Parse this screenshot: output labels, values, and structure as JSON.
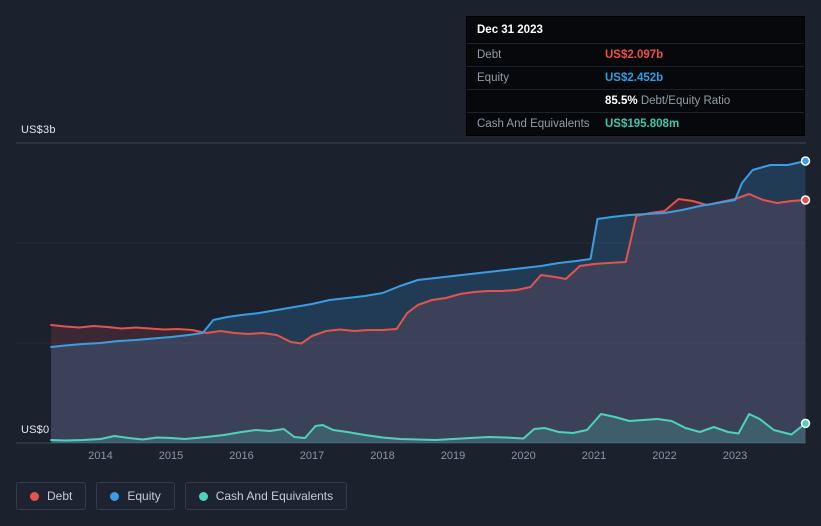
{
  "tooltip": {
    "date": "Dec 31 2023",
    "debt_label": "Debt",
    "debt_value": "US$2.097b",
    "equity_label": "Equity",
    "equity_value": "US$2.452b",
    "ratio_value": "85.5%",
    "ratio_label": "Debt/Equity Ratio",
    "cash_label": "Cash And Equivalents",
    "cash_value": "US$195.808m"
  },
  "chart": {
    "y_axis_top_label": "US$3b",
    "y_axis_bottom_label": "US$0"
  },
  "legend": {
    "items": [
      {
        "label": "Debt",
        "color": "#e5534f"
      },
      {
        "label": "Equity",
        "color": "#3b9de4"
      },
      {
        "label": "Cash And Equivalents",
        "color": "#4fd2bd"
      }
    ]
  },
  "chart_data": {
    "type": "area",
    "title": "",
    "xlabel": "",
    "ylabel": "US$",
    "unit": "US$ billions",
    "ylim": [
      0,
      3
    ],
    "x_ticks": [
      2014,
      2015,
      2016,
      2017,
      2018,
      2019,
      2020,
      2021,
      2022,
      2023
    ],
    "grid": true,
    "legend_position": "bottom-left",
    "series": [
      {
        "name": "Debt",
        "color": "#e5534f",
        "fill": "rgba(229,83,79,0.16)",
        "points": [
          [
            2013.3,
            1.18
          ],
          [
            2013.5,
            1.165
          ],
          [
            2013.7,
            1.155
          ],
          [
            2013.9,
            1.17
          ],
          [
            2014.1,
            1.16
          ],
          [
            2014.3,
            1.145
          ],
          [
            2014.5,
            1.155
          ],
          [
            2014.7,
            1.145
          ],
          [
            2014.9,
            1.135
          ],
          [
            2015.1,
            1.14
          ],
          [
            2015.3,
            1.13
          ],
          [
            2015.5,
            1.1
          ],
          [
            2015.7,
            1.12
          ],
          [
            2015.9,
            1.1
          ],
          [
            2016.1,
            1.09
          ],
          [
            2016.3,
            1.1
          ],
          [
            2016.5,
            1.08
          ],
          [
            2016.7,
            1.01
          ],
          [
            2016.85,
            0.995
          ],
          [
            2017.0,
            1.07
          ],
          [
            2017.2,
            1.12
          ],
          [
            2017.4,
            1.135
          ],
          [
            2017.6,
            1.12
          ],
          [
            2017.8,
            1.13
          ],
          [
            2018.0,
            1.13
          ],
          [
            2018.2,
            1.14
          ],
          [
            2018.35,
            1.3
          ],
          [
            2018.5,
            1.38
          ],
          [
            2018.7,
            1.43
          ],
          [
            2018.9,
            1.45
          ],
          [
            2019.1,
            1.49
          ],
          [
            2019.3,
            1.51
          ],
          [
            2019.5,
            1.52
          ],
          [
            2019.7,
            1.52
          ],
          [
            2019.9,
            1.53
          ],
          [
            2020.1,
            1.56
          ],
          [
            2020.25,
            1.68
          ],
          [
            2020.45,
            1.66
          ],
          [
            2020.6,
            1.64
          ],
          [
            2020.8,
            1.77
          ],
          [
            2021.0,
            1.79
          ],
          [
            2021.2,
            1.8
          ],
          [
            2021.45,
            1.81
          ],
          [
            2021.6,
            2.27
          ],
          [
            2021.8,
            2.3
          ],
          [
            2022.0,
            2.32
          ],
          [
            2022.2,
            2.44
          ],
          [
            2022.4,
            2.42
          ],
          [
            2022.6,
            2.38
          ],
          [
            2022.8,
            2.41
          ],
          [
            2023.0,
            2.44
          ],
          [
            2023.2,
            2.49
          ],
          [
            2023.4,
            2.43
          ],
          [
            2023.6,
            2.4
          ],
          [
            2023.8,
            2.42
          ],
          [
            2024.0,
            2.43
          ]
        ]
      },
      {
        "name": "Equity",
        "color": "#3b9de4",
        "fill": "rgba(59,157,228,0.22)",
        "points": [
          [
            2013.3,
            0.96
          ],
          [
            2013.5,
            0.975
          ],
          [
            2013.75,
            0.99
          ],
          [
            2014.0,
            1.0
          ],
          [
            2014.25,
            1.02
          ],
          [
            2014.5,
            1.03
          ],
          [
            2014.75,
            1.045
          ],
          [
            2015.0,
            1.06
          ],
          [
            2015.25,
            1.08
          ],
          [
            2015.45,
            1.1
          ],
          [
            2015.6,
            1.23
          ],
          [
            2015.8,
            1.26
          ],
          [
            2016.0,
            1.28
          ],
          [
            2016.25,
            1.3
          ],
          [
            2016.5,
            1.33
          ],
          [
            2016.75,
            1.36
          ],
          [
            2017.0,
            1.39
          ],
          [
            2017.25,
            1.43
          ],
          [
            2017.5,
            1.45
          ],
          [
            2017.75,
            1.47
          ],
          [
            2018.0,
            1.5
          ],
          [
            2018.25,
            1.57
          ],
          [
            2018.5,
            1.63
          ],
          [
            2018.75,
            1.65
          ],
          [
            2019.0,
            1.67
          ],
          [
            2019.25,
            1.69
          ],
          [
            2019.5,
            1.71
          ],
          [
            2019.75,
            1.73
          ],
          [
            2020.0,
            1.75
          ],
          [
            2020.25,
            1.77
          ],
          [
            2020.5,
            1.8
          ],
          [
            2020.75,
            1.82
          ],
          [
            2020.95,
            1.84
          ],
          [
            2021.05,
            2.24
          ],
          [
            2021.25,
            2.26
          ],
          [
            2021.5,
            2.28
          ],
          [
            2021.75,
            2.29
          ],
          [
            2022.0,
            2.3
          ],
          [
            2022.25,
            2.33
          ],
          [
            2022.5,
            2.37
          ],
          [
            2022.75,
            2.4
          ],
          [
            2023.0,
            2.43
          ],
          [
            2023.1,
            2.6
          ],
          [
            2023.25,
            2.73
          ],
          [
            2023.5,
            2.78
          ],
          [
            2023.75,
            2.78
          ],
          [
            2024.0,
            2.82
          ]
        ]
      },
      {
        "name": "Cash And Equivalents",
        "color": "#4fd2bd",
        "fill": "rgba(79,210,189,0.2)",
        "points": [
          [
            2013.3,
            0.03
          ],
          [
            2013.5,
            0.025
          ],
          [
            2013.75,
            0.03
          ],
          [
            2014.0,
            0.04
          ],
          [
            2014.2,
            0.07
          ],
          [
            2014.4,
            0.05
          ],
          [
            2014.6,
            0.035
          ],
          [
            2014.8,
            0.055
          ],
          [
            2015.0,
            0.05
          ],
          [
            2015.2,
            0.04
          ],
          [
            2015.5,
            0.06
          ],
          [
            2015.75,
            0.08
          ],
          [
            2016.0,
            0.11
          ],
          [
            2016.2,
            0.13
          ],
          [
            2016.4,
            0.12
          ],
          [
            2016.6,
            0.14
          ],
          [
            2016.75,
            0.06
          ],
          [
            2016.9,
            0.05
          ],
          [
            2017.05,
            0.17
          ],
          [
            2017.15,
            0.18
          ],
          [
            2017.3,
            0.13
          ],
          [
            2017.5,
            0.11
          ],
          [
            2017.75,
            0.08
          ],
          [
            2018.0,
            0.055
          ],
          [
            2018.25,
            0.04
          ],
          [
            2018.5,
            0.035
          ],
          [
            2018.75,
            0.03
          ],
          [
            2019.0,
            0.04
          ],
          [
            2019.25,
            0.05
          ],
          [
            2019.5,
            0.06
          ],
          [
            2019.75,
            0.055
          ],
          [
            2020.0,
            0.045
          ],
          [
            2020.15,
            0.14
          ],
          [
            2020.3,
            0.15
          ],
          [
            2020.5,
            0.11
          ],
          [
            2020.7,
            0.1
          ],
          [
            2020.9,
            0.13
          ],
          [
            2021.1,
            0.29
          ],
          [
            2021.3,
            0.26
          ],
          [
            2021.5,
            0.22
          ],
          [
            2021.7,
            0.23
          ],
          [
            2021.9,
            0.24
          ],
          [
            2022.1,
            0.22
          ],
          [
            2022.3,
            0.15
          ],
          [
            2022.5,
            0.11
          ],
          [
            2022.7,
            0.16
          ],
          [
            2022.9,
            0.11
          ],
          [
            2023.05,
            0.095
          ],
          [
            2023.2,
            0.29
          ],
          [
            2023.35,
            0.24
          ],
          [
            2023.55,
            0.13
          ],
          [
            2023.8,
            0.085
          ],
          [
            2024.0,
            0.196
          ]
        ]
      }
    ]
  }
}
